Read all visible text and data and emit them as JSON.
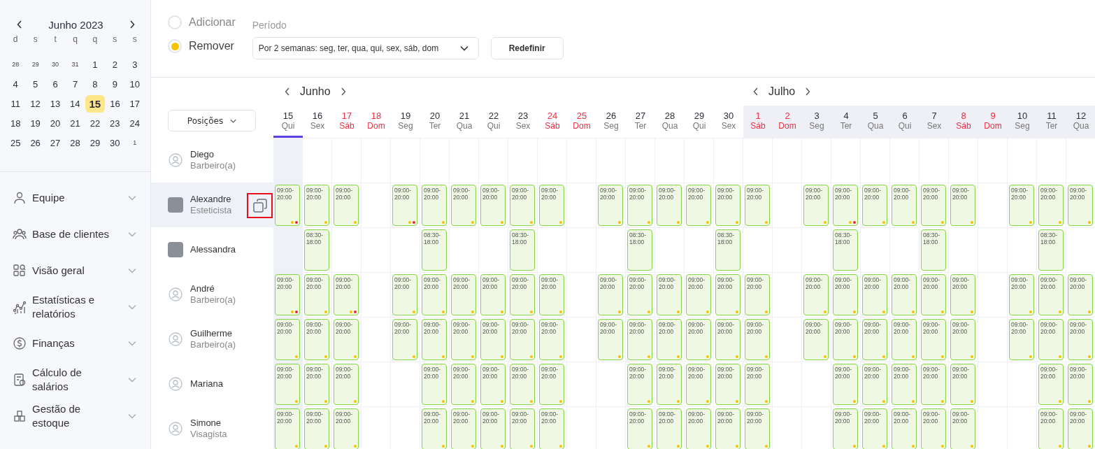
{
  "mini_calendar": {
    "title": "Junho 2023",
    "weekdays": [
      "d",
      "s",
      "t",
      "q",
      "q",
      "s",
      "s"
    ],
    "weeks": [
      [
        {
          "day": "28",
          "outside": true,
          "selected": false
        },
        {
          "day": "29",
          "outside": true,
          "selected": false
        },
        {
          "day": "30",
          "outside": true,
          "selected": false
        },
        {
          "day": "31",
          "outside": true,
          "selected": false
        },
        {
          "day": "1",
          "outside": false,
          "selected": false
        },
        {
          "day": "2",
          "outside": false,
          "selected": false
        },
        {
          "day": "3",
          "outside": false,
          "selected": false
        }
      ],
      [
        {
          "day": "4",
          "outside": false,
          "selected": false
        },
        {
          "day": "5",
          "outside": false,
          "selected": false
        },
        {
          "day": "6",
          "outside": false,
          "selected": false
        },
        {
          "day": "7",
          "outside": false,
          "selected": false
        },
        {
          "day": "8",
          "outside": false,
          "selected": false
        },
        {
          "day": "9",
          "outside": false,
          "selected": false
        },
        {
          "day": "10",
          "outside": false,
          "selected": false
        }
      ],
      [
        {
          "day": "11",
          "outside": false,
          "selected": false
        },
        {
          "day": "12",
          "outside": false,
          "selected": false
        },
        {
          "day": "13",
          "outside": false,
          "selected": false
        },
        {
          "day": "14",
          "outside": false,
          "selected": false
        },
        {
          "day": "15",
          "outside": false,
          "selected": true
        },
        {
          "day": "16",
          "outside": false,
          "selected": false
        },
        {
          "day": "17",
          "outside": false,
          "selected": false
        }
      ],
      [
        {
          "day": "18",
          "outside": false,
          "selected": false
        },
        {
          "day": "19",
          "outside": false,
          "selected": false
        },
        {
          "day": "20",
          "outside": false,
          "selected": false
        },
        {
          "day": "21",
          "outside": false,
          "selected": false
        },
        {
          "day": "22",
          "outside": false,
          "selected": false
        },
        {
          "day": "23",
          "outside": false,
          "selected": false
        },
        {
          "day": "24",
          "outside": false,
          "selected": false
        }
      ],
      [
        {
          "day": "25",
          "outside": false,
          "selected": false
        },
        {
          "day": "26",
          "outside": false,
          "selected": false
        },
        {
          "day": "27",
          "outside": false,
          "selected": false
        },
        {
          "day": "28",
          "outside": false,
          "selected": false
        },
        {
          "day": "29",
          "outside": false,
          "selected": false
        },
        {
          "day": "30",
          "outside": false,
          "selected": false
        },
        {
          "day": "1",
          "outside": true,
          "selected": false
        }
      ]
    ]
  },
  "sidebar": {
    "items": [
      {
        "label": "Equipe"
      },
      {
        "label": "Base de clientes"
      },
      {
        "label": "Visão geral"
      },
      {
        "label": "Estatísticas e relatórios"
      },
      {
        "label": "Finanças"
      },
      {
        "label": "Cálculo de salários"
      },
      {
        "label": "Gestão de estoque"
      }
    ]
  },
  "mode": {
    "options": [
      {
        "label": "Adicionar",
        "selected": false
      },
      {
        "label": "Remover",
        "selected": true
      }
    ]
  },
  "period": {
    "label": "Período",
    "value": "Por 2 semanas: seg, ter, qua, qui, sex, sáb, dom"
  },
  "reset_button": "Redefinir",
  "positions_button": "Posições",
  "months": [
    {
      "name": "Junho",
      "shaded": false,
      "days": [
        {
          "date": "15",
          "weekday": "Qui",
          "weekend": false,
          "selected": true
        },
        {
          "date": "16",
          "weekday": "Sex",
          "weekend": false,
          "selected": false
        },
        {
          "date": "17",
          "weekday": "Sáb",
          "weekend": true,
          "selected": false
        },
        {
          "date": "18",
          "weekday": "Dom",
          "weekend": true,
          "selected": false
        },
        {
          "date": "19",
          "weekday": "Seg",
          "weekend": false,
          "selected": false
        },
        {
          "date": "20",
          "weekday": "Ter",
          "weekend": false,
          "selected": false
        },
        {
          "date": "21",
          "weekday": "Qua",
          "weekend": false,
          "selected": false
        },
        {
          "date": "22",
          "weekday": "Qui",
          "weekend": false,
          "selected": false
        },
        {
          "date": "23",
          "weekday": "Sex",
          "weekend": false,
          "selected": false
        },
        {
          "date": "24",
          "weekday": "Sáb",
          "weekend": true,
          "selected": false
        },
        {
          "date": "25",
          "weekday": "Dom",
          "weekend": true,
          "selected": false
        },
        {
          "date": "26",
          "weekday": "Seg",
          "weekend": false,
          "selected": false
        },
        {
          "date": "27",
          "weekday": "Ter",
          "weekend": false,
          "selected": false
        },
        {
          "date": "28",
          "weekday": "Qua",
          "weekend": false,
          "selected": false
        },
        {
          "date": "29",
          "weekday": "Qui",
          "weekend": false,
          "selected": false
        },
        {
          "date": "30",
          "weekday": "Sex",
          "weekend": false,
          "selected": false
        }
      ]
    },
    {
      "name": "Julho",
      "shaded": true,
      "days": [
        {
          "date": "1",
          "weekday": "Sáb",
          "weekend": true,
          "selected": false
        },
        {
          "date": "2",
          "weekday": "Dom",
          "weekend": true,
          "selected": false
        },
        {
          "date": "3",
          "weekday": "Seg",
          "weekend": false,
          "selected": false
        },
        {
          "date": "4",
          "weekday": "Ter",
          "weekend": false,
          "selected": false
        },
        {
          "date": "5",
          "weekday": "Qua",
          "weekend": false,
          "selected": false
        },
        {
          "date": "6",
          "weekday": "Qui",
          "weekend": false,
          "selected": false
        },
        {
          "date": "7",
          "weekday": "Sex",
          "weekend": false,
          "selected": false
        },
        {
          "date": "8",
          "weekday": "Sáb",
          "weekend": true,
          "selected": false
        },
        {
          "date": "9",
          "weekday": "Dom",
          "weekend": true,
          "selected": false
        },
        {
          "date": "10",
          "weekday": "Seg",
          "weekend": false,
          "selected": false
        },
        {
          "date": "11",
          "weekday": "Ter",
          "weekend": false,
          "selected": false
        },
        {
          "date": "12",
          "weekday": "Qua",
          "weekend": false,
          "selected": false
        }
      ]
    }
  ],
  "staff": [
    {
      "name": "Diego",
      "role": "Barbeiro(a)",
      "kind": "default",
      "selected": false,
      "cells": [
        null,
        null,
        null,
        null,
        null,
        null,
        null,
        null,
        null,
        null,
        null,
        null,
        null,
        null,
        null,
        null,
        null,
        null,
        null,
        null,
        null,
        null,
        null,
        null,
        null,
        null,
        null,
        null
      ]
    },
    {
      "name": "Alexandre",
      "role": "Esteticista",
      "kind": "photo",
      "selected": true,
      "cells": [
        {
          "time": "09:00-20:00",
          "dots": [
            {
              "color": "#f5c400"
            },
            {
              "color": "#f0283c"
            }
          ]
        },
        {
          "time": "09:00-20:00",
          "dots": [
            {
              "color": "#f5c400"
            }
          ]
        },
        {
          "time": "09:00-20:00",
          "dots": [
            {
              "color": "#f5c400"
            }
          ]
        },
        null,
        {
          "time": "09:00-20:00",
          "dots": [
            {
              "color": "#f5c400"
            },
            {
              "color": "#f0283c"
            }
          ]
        },
        {
          "time": "09:00-20:00",
          "dots": [
            {
              "color": "#f5c400"
            }
          ]
        },
        {
          "time": "09:00-20:00",
          "dots": [
            {
              "color": "#f5c400"
            }
          ]
        },
        {
          "time": "09:00-20:00",
          "dots": [
            {
              "color": "#f5c400"
            }
          ]
        },
        {
          "time": "09:00-20:00",
          "dots": [
            {
              "color": "#f5c400"
            }
          ]
        },
        {
          "time": "09:00-20:00",
          "dots": [
            {
              "color": "#f5c400"
            }
          ]
        },
        null,
        {
          "time": "09:00-20:00",
          "dots": [
            {
              "color": "#f5c400"
            }
          ]
        },
        {
          "time": "09:00-20:00",
          "dots": [
            {
              "color": "#f5c400"
            }
          ]
        },
        {
          "time": "09:00-20:00",
          "dots": [
            {
              "color": "#f5c400"
            }
          ]
        },
        {
          "time": "09:00-20:00",
          "dots": [
            {
              "color": "#f5c400"
            }
          ]
        },
        {
          "time": "09:00-20:00",
          "dots": [
            {
              "color": "#f5c400"
            }
          ]
        },
        {
          "time": "09:00-20:00",
          "dots": [
            {
              "color": "#f5c400"
            }
          ]
        },
        null,
        {
          "time": "09:00-20:00",
          "dots": [
            {
              "color": "#f5c400"
            }
          ]
        },
        {
          "time": "09:00-20:00",
          "dots": [
            {
              "color": "#f5c400"
            },
            {
              "color": "#f0283c"
            }
          ]
        },
        {
          "time": "09:00-20:00",
          "dots": [
            {
              "color": "#f5c400"
            }
          ]
        },
        {
          "time": "09:00-20:00",
          "dots": [
            {
              "color": "#f5c400"
            }
          ]
        },
        {
          "time": "09:00-20:00",
          "dots": [
            {
              "color": "#f5c400"
            }
          ]
        },
        {
          "time": "09:00-20:00",
          "dots": [
            {
              "color": "#f5c400"
            }
          ]
        },
        null,
        {
          "time": "09:00-20:00",
          "dots": [
            {
              "color": "#f5c400"
            }
          ]
        },
        {
          "time": "09:00-20:00",
          "dots": [
            {
              "color": "#f5c400"
            }
          ]
        },
        {
          "time": "09:00-20:00",
          "dots": [
            {
              "color": "#f5c400"
            }
          ]
        }
      ]
    },
    {
      "name": "Alessandra",
      "kind": "photo",
      "selected": false,
      "cells": [
        null,
        {
          "time": "08:30-18:00"
        },
        null,
        null,
        null,
        {
          "time": "08:30-18:00"
        },
        null,
        null,
        {
          "time": "08:30-18:00"
        },
        null,
        null,
        null,
        {
          "time": "08:30-18:00"
        },
        null,
        null,
        {
          "time": "08:30-18:00"
        },
        null,
        null,
        null,
        {
          "time": "08:30-18:00"
        },
        null,
        null,
        {
          "time": "08:30-18:00"
        },
        null,
        null,
        null,
        {
          "time": "08:30-18:00"
        },
        null
      ]
    },
    {
      "name": "André",
      "role": "Barbeiro(a)",
      "kind": "default",
      "selected": false,
      "cells": [
        {
          "time": "09:00-20:00",
          "dots": [
            {
              "color": "#f5c400"
            },
            {
              "color": "#f0283c"
            }
          ]
        },
        {
          "time": "09:00-20:00",
          "dots": [
            {
              "color": "#f5c400"
            }
          ]
        },
        {
          "time": "09:00-20:00",
          "dots": [
            {
              "color": "#f5c400"
            },
            {
              "color": "#f0283c"
            }
          ]
        },
        null,
        {
          "time": "09:00-20:00",
          "dots": [
            {
              "color": "#f5c400"
            }
          ]
        },
        {
          "time": "09:00-20:00",
          "dots": [
            {
              "color": "#f5c400"
            }
          ]
        },
        {
          "time": "09:00-20:00",
          "dots": [
            {
              "color": "#f5c400"
            }
          ]
        },
        {
          "time": "09:00-20:00",
          "dots": [
            {
              "color": "#f5c400"
            }
          ]
        },
        {
          "time": "09:00-20:00",
          "dots": [
            {
              "color": "#f5c400"
            }
          ]
        },
        {
          "time": "09:00-20:00",
          "dots": [
            {
              "color": "#f5c400"
            }
          ]
        },
        null,
        {
          "time": "09:00-20:00",
          "dots": [
            {
              "color": "#f5c400"
            }
          ]
        },
        {
          "time": "09:00-20:00",
          "dots": [
            {
              "color": "#f5c400"
            }
          ]
        },
        {
          "time": "09:00-20:00",
          "dots": [
            {
              "color": "#f5c400"
            }
          ]
        },
        {
          "time": "09:00-20:00",
          "dots": [
            {
              "color": "#f5c400"
            }
          ]
        },
        {
          "time": "09:00-20:00",
          "dots": [
            {
              "color": "#f5c400"
            }
          ]
        },
        {
          "time": "09:00-20:00",
          "dots": [
            {
              "color": "#f5c400"
            }
          ]
        },
        null,
        {
          "time": "09:00-20:00",
          "dots": [
            {
              "color": "#f5c400"
            }
          ]
        },
        {
          "time": "09:00-20:00",
          "dots": [
            {
              "color": "#f5c400"
            }
          ]
        },
        {
          "time": "09:00-20:00",
          "dots": [
            {
              "color": "#f5c400"
            }
          ]
        },
        {
          "time": "09:00-20:00",
          "dots": [
            {
              "color": "#f5c400"
            }
          ]
        },
        {
          "time": "09:00-20:00",
          "dots": [
            {
              "color": "#f5c400"
            }
          ]
        },
        {
          "time": "09:00-20:00",
          "dots": [
            {
              "color": "#f5c400"
            }
          ]
        },
        null,
        {
          "time": "09:00-20:00",
          "dots": [
            {
              "color": "#f5c400"
            }
          ]
        },
        {
          "time": "09:00-20:00",
          "dots": [
            {
              "color": "#f5c400"
            }
          ]
        },
        {
          "time": "09:00-20:00",
          "dots": [
            {
              "color": "#f5c400"
            }
          ]
        }
      ]
    },
    {
      "name": "Guilherme",
      "role": "Barbeiro(a)",
      "kind": "default",
      "selected": false,
      "cells": [
        {
          "time": "09:00-20:00",
          "dots": [
            {
              "color": "#f5c400"
            }
          ]
        },
        {
          "time": "09:00-20:00",
          "dots": [
            {
              "color": "#f5c400"
            }
          ]
        },
        {
          "time": "09:00-20:00",
          "dots": [
            {
              "color": "#f5c400"
            }
          ]
        },
        null,
        {
          "time": "09:00-20:00",
          "dots": [
            {
              "color": "#f5c400"
            }
          ]
        },
        {
          "time": "09:00-20:00",
          "dots": [
            {
              "color": "#f5c400"
            }
          ]
        },
        {
          "time": "09:00-20:00",
          "dots": [
            {
              "color": "#f5c400"
            }
          ]
        },
        {
          "time": "09:00-20:00",
          "dots": [
            {
              "color": "#f5c400"
            }
          ]
        },
        {
          "time": "09:00-20:00",
          "dots": [
            {
              "color": "#f5c400"
            }
          ]
        },
        {
          "time": "09:00-20:00",
          "dots": [
            {
              "color": "#f5c400"
            }
          ]
        },
        null,
        {
          "time": "09:00-20:00",
          "dots": [
            {
              "color": "#f5c400"
            }
          ]
        },
        {
          "time": "09:00-20:00",
          "dots": [
            {
              "color": "#f5c400"
            }
          ]
        },
        {
          "time": "09:00-20:00",
          "dots": [
            {
              "color": "#f5c400"
            }
          ]
        },
        {
          "time": "09:00-20:00",
          "dots": [
            {
              "color": "#f5c400"
            }
          ]
        },
        {
          "time": "09:00-20:00",
          "dots": [
            {
              "color": "#f5c400"
            }
          ]
        },
        {
          "time": "09:00-20:00",
          "dots": [
            {
              "color": "#f5c400"
            }
          ]
        },
        null,
        {
          "time": "09:00-20:00",
          "dots": [
            {
              "color": "#f5c400"
            }
          ]
        },
        {
          "time": "09:00-20:00",
          "dots": [
            {
              "color": "#f5c400"
            }
          ]
        },
        {
          "time": "09:00-20:00",
          "dots": [
            {
              "color": "#f5c400"
            }
          ]
        },
        {
          "time": "09:00-20:00",
          "dots": [
            {
              "color": "#f5c400"
            }
          ]
        },
        {
          "time": "09:00-20:00",
          "dots": [
            {
              "color": "#f5c400"
            }
          ]
        },
        {
          "time": "09:00-20:00",
          "dots": [
            {
              "color": "#f5c400"
            }
          ]
        },
        null,
        {
          "time": "09:00-20:00",
          "dots": [
            {
              "color": "#f5c400"
            }
          ]
        },
        {
          "time": "09:00-20:00",
          "dots": [
            {
              "color": "#f5c400"
            }
          ]
        },
        {
          "time": "09:00-20:00",
          "dots": [
            {
              "color": "#f5c400"
            }
          ]
        }
      ]
    },
    {
      "name": "Mariana",
      "kind": "default",
      "selected": false,
      "cells": [
        {
          "time": "09:00-20:00",
          "dots": [
            {
              "color": "#f5c400"
            }
          ]
        },
        {
          "time": "09:00-20:00",
          "dots": [
            {
              "color": "#f5c400"
            }
          ]
        },
        {
          "time": "09:00-20:00",
          "dots": [
            {
              "color": "#f5c400"
            }
          ]
        },
        null,
        null,
        {
          "time": "09:00-20:00",
          "dots": [
            {
              "color": "#f5c400"
            }
          ]
        },
        {
          "time": "09:00-20:00",
          "dots": [
            {
              "color": "#f5c400"
            }
          ]
        },
        {
          "time": "09:00-20:00",
          "dots": [
            {
              "color": "#f5c400"
            }
          ]
        },
        {
          "time": "09:00-20:00",
          "dots": [
            {
              "color": "#f5c400"
            }
          ]
        },
        {
          "time": "09:00-20:00",
          "dots": [
            {
              "color": "#f5c400"
            }
          ]
        },
        null,
        null,
        {
          "time": "09:00-20:00",
          "dots": [
            {
              "color": "#f5c400"
            }
          ]
        },
        {
          "time": "09:00-20:00",
          "dots": [
            {
              "color": "#f5c400"
            }
          ]
        },
        {
          "time": "09:00-20:00",
          "dots": [
            {
              "color": "#f5c400"
            }
          ]
        },
        {
          "time": "09:00-20:00",
          "dots": [
            {
              "color": "#f5c400"
            }
          ]
        },
        {
          "time": "09:00-20:00",
          "dots": [
            {
              "color": "#f5c400"
            }
          ]
        },
        null,
        null,
        {
          "time": "09:00-20:00",
          "dots": [
            {
              "color": "#f5c400"
            }
          ]
        },
        {
          "time": "09:00-20:00",
          "dots": [
            {
              "color": "#f5c400"
            }
          ]
        },
        {
          "time": "09:00-20:00",
          "dots": [
            {
              "color": "#f5c400"
            }
          ]
        },
        {
          "time": "09:00-20:00",
          "dots": [
            {
              "color": "#f5c400"
            }
          ]
        },
        {
          "time": "09:00-20:00",
          "dots": [
            {
              "color": "#f5c400"
            }
          ]
        },
        null,
        null,
        {
          "time": "09:00-20:00",
          "dots": [
            {
              "color": "#f5c400"
            }
          ]
        },
        {
          "time": "09:00-20:00",
          "dots": [
            {
              "color": "#f5c400"
            }
          ]
        }
      ]
    },
    {
      "name": "Simone",
      "role": "Visagista",
      "kind": "default",
      "selected": false,
      "cells": [
        {
          "time": "09:00-20:00",
          "dots": [
            {
              "color": "#f5c400"
            }
          ]
        },
        {
          "time": "09:00-20:00",
          "dots": [
            {
              "color": "#f5c400"
            }
          ]
        },
        {
          "time": "09:00-20:00",
          "dots": [
            {
              "color": "#f5c400"
            }
          ]
        },
        null,
        null,
        {
          "time": "09:00-20:00",
          "dots": [
            {
              "color": "#f5c400"
            }
          ]
        },
        {
          "time": "09:00-20:00",
          "dots": [
            {
              "color": "#f5c400"
            }
          ]
        },
        {
          "time": "09:00-20:00",
          "dots": [
            {
              "color": "#f5c400"
            }
          ]
        },
        {
          "time": "09:00-20:00",
          "dots": [
            {
              "color": "#f5c400"
            }
          ]
        },
        {
          "time": "09:00-20:00",
          "dots": [
            {
              "color": "#f5c400"
            }
          ]
        },
        null,
        null,
        {
          "time": "09:00-20:00",
          "dots": [
            {
              "color": "#f5c400"
            }
          ]
        },
        {
          "time": "09:00-20:00",
          "dots": [
            {
              "color": "#f5c400"
            }
          ]
        },
        {
          "time": "09:00-20:00",
          "dots": [
            {
              "color": "#f5c400"
            }
          ]
        },
        {
          "time": "09:00-20:00",
          "dots": [
            {
              "color": "#f5c400"
            }
          ]
        },
        {
          "time": "09:00-20:00",
          "dots": [
            {
              "color": "#f5c400"
            }
          ]
        },
        null,
        null,
        {
          "time": "09:00-20:00",
          "dots": [
            {
              "color": "#f5c400"
            }
          ]
        },
        {
          "time": "09:00-20:00",
          "dots": [
            {
              "color": "#f5c400"
            }
          ]
        },
        {
          "time": "09:00-20:00",
          "dots": [
            {
              "color": "#f5c400"
            }
          ]
        },
        {
          "time": "09:00-20:00",
          "dots": [
            {
              "color": "#f5c400"
            }
          ]
        },
        {
          "time": "09:00-20:00",
          "dots": [
            {
              "color": "#f5c400"
            }
          ]
        },
        null,
        null,
        {
          "time": "09:00-20:00",
          "dots": [
            {
              "color": "#f5c400"
            }
          ]
        },
        {
          "time": "09:00-20:00",
          "dots": [
            {
              "color": "#f5c400"
            }
          ]
        }
      ]
    }
  ]
}
